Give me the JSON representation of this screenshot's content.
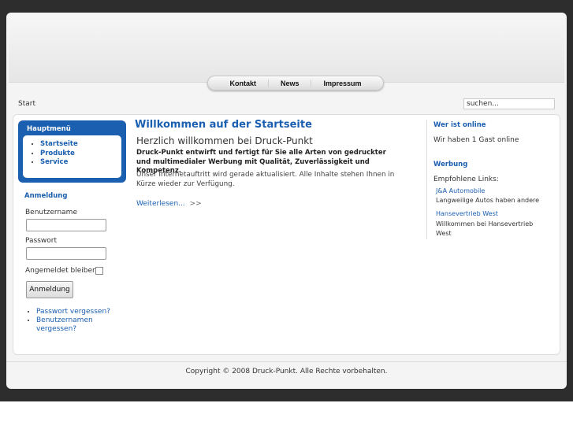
{
  "nav": [
    "Kontakt",
    "News",
    "Impressum"
  ],
  "breadcrumb": "Start",
  "search": {
    "placeholder": "suchen..."
  },
  "mainmenu": {
    "title": "Hauptmenü",
    "items": [
      "Startseite",
      "Produkte",
      "Service"
    ]
  },
  "login": {
    "title": "Anmeldung",
    "username_label": "Benutzername",
    "password_label": "Passwort",
    "remember_label": "Angemeldet bleiben",
    "submit": "Anmeldung",
    "links": [
      "Passwort vergessen?",
      "Benutzernamen vergessen?"
    ]
  },
  "article": {
    "title": "Willkommen auf der Startseite",
    "subtitle": "Herzlich willkommen bei Druck-Punkt",
    "lead": "Druck-Punkt entwirft und fertigt für Sie alle Arten von gedruckter und multimedialer Werbung mit Qualität, Zuverlässigkeit und Kompetenz.",
    "body": "Unser Internetauftritt wird gerade aktualisiert. Alle Inhalte stehen Ihnen in Kürze wieder zur Verfügung.",
    "readmore": "Weiterlesen...",
    "readmore_arrow": ">>"
  },
  "online": {
    "title": "Wer ist online",
    "text": "Wir haben 1 Gast online"
  },
  "ads": {
    "title": "Werbung",
    "intro": "Empfohlene Links:",
    "items": [
      {
        "name": "J&A Automobile",
        "desc": "Langweilige Autos haben andere"
      },
      {
        "name": "Hansevertrieb West",
        "desc": "Willkommen bei Hansevertrieb West"
      }
    ]
  },
  "footer": "Copyright © 2008 Druck-Punkt. Alle Rechte vorbehalten."
}
